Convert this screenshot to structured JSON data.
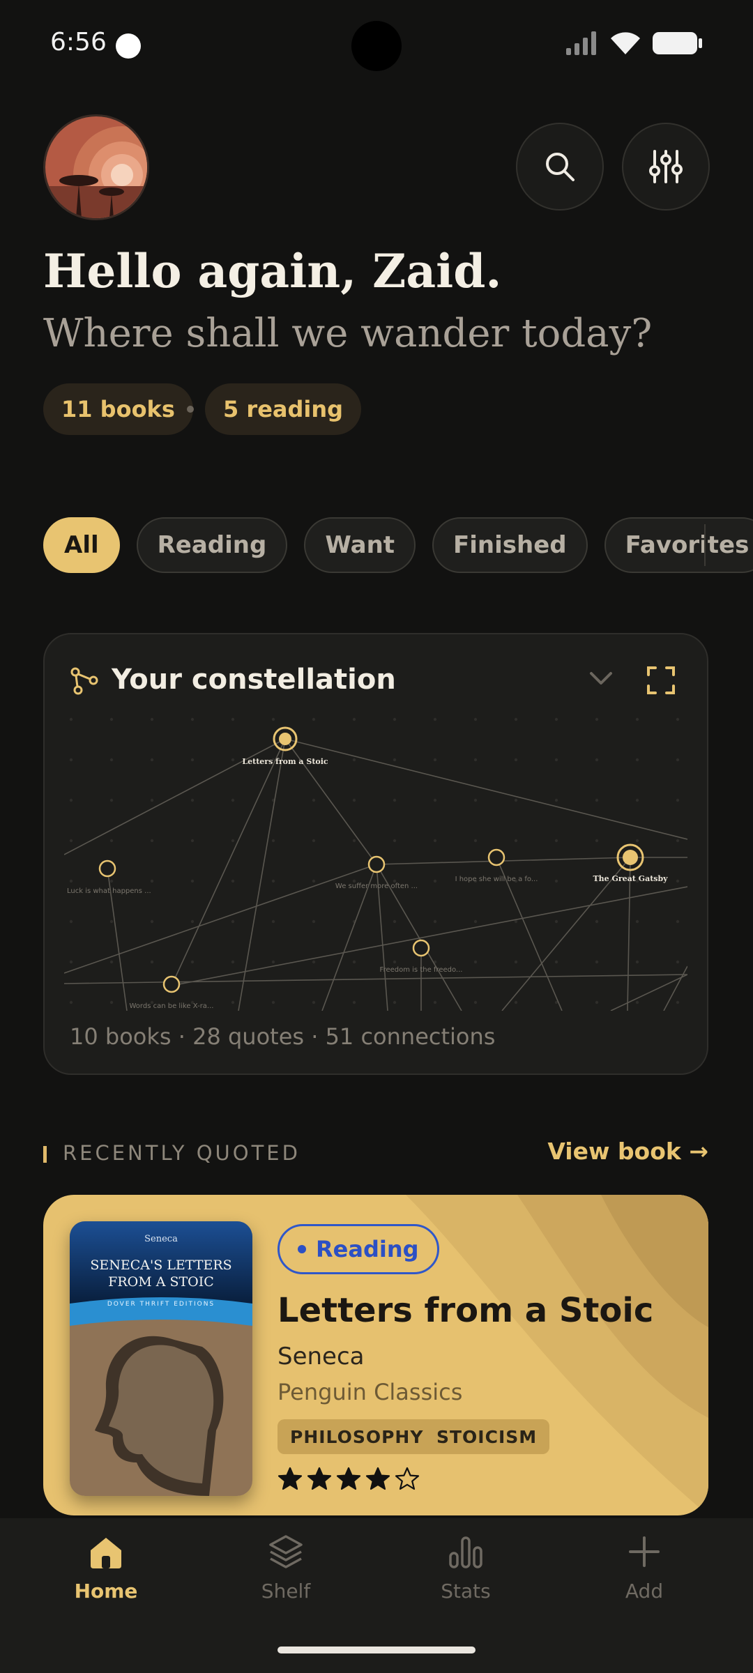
{
  "status_bar": {
    "time": "6:56"
  },
  "header": {
    "greeting": "Hello again, Zaid.",
    "subtitle": "Where shall we wander today?",
    "chips": {
      "books": "11 books",
      "reading": "5 reading"
    }
  },
  "filters": [
    {
      "label": "All",
      "active": true
    },
    {
      "label": "Reading",
      "active": false
    },
    {
      "label": "Want",
      "active": false
    },
    {
      "label": "Finished",
      "active": false
    },
    {
      "label": "Favorites",
      "active": false
    }
  ],
  "constellation": {
    "title": "Your constellation",
    "meta": "10 books · 28 quotes · 51 connections",
    "nodes": [
      {
        "label": "Letters from a Stoic",
        "major": true
      },
      {
        "label": "Luck is what happens ...",
        "major": false
      },
      {
        "label": "We suffer more often ...",
        "major": false
      },
      {
        "label": "I hope she will be a fo...",
        "major": false
      },
      {
        "label": "The Great Gatsby",
        "major": true
      },
      {
        "label": "Freedom is the freedo...",
        "major": false
      },
      {
        "label": "Words can be like X-ra...",
        "major": false
      }
    ]
  },
  "recently_quoted": {
    "label": "RECENTLY QUOTED",
    "link": "View book →",
    "book": {
      "status": "Reading",
      "title": "Letters from a Stoic",
      "author": "Seneca",
      "publisher": "Penguin Classics",
      "tags": [
        "PHILOSOPHY",
        "STOICISM"
      ],
      "rating": 4,
      "rating_max": 5,
      "cover": {
        "author": "Seneca",
        "title_line1": "SENECA'S LETTERS",
        "title_line2": "FROM A STOIC",
        "edition": "DOVER THRIFT EDITIONS"
      }
    }
  },
  "nav": [
    {
      "label": "Home",
      "icon": "home-icon",
      "active": true
    },
    {
      "label": "Shelf",
      "icon": "layers-icon",
      "active": false
    },
    {
      "label": "Stats",
      "icon": "stats-icon",
      "active": false
    },
    {
      "label": "Add",
      "icon": "plus-icon",
      "active": false
    }
  ],
  "colors": {
    "accent": "#e8c471",
    "background": "#121211",
    "card": "#e6c16f",
    "status_blue": "#2c50c4"
  }
}
